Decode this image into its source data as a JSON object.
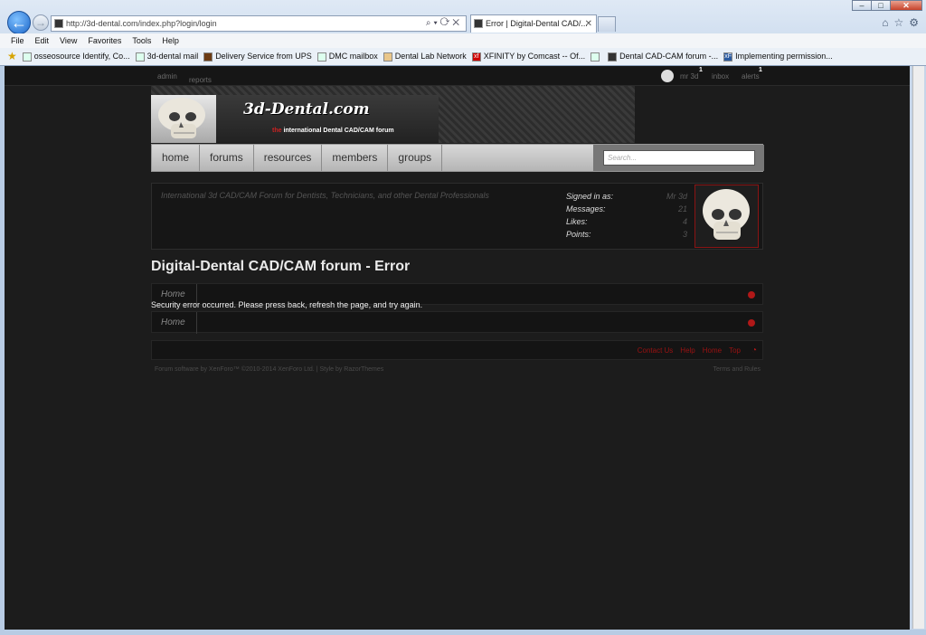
{
  "browser": {
    "address": "http://3d-dental.com/index.php?login/login",
    "tab_title": "Error | Digital-Dental CAD/...",
    "menu": [
      "File",
      "Edit",
      "View",
      "Favorites",
      "Tools",
      "Help"
    ],
    "favorites": [
      "osseosource Identify, Co...",
      "3d-dental mail",
      "Delivery Service from UPS",
      "DMC mailbox",
      "Dental Lab Network",
      "XFINITY by Comcast -- Of...",
      "",
      "Dental CAD-CAM forum -...",
      "Implementing permission..."
    ]
  },
  "topbar": {
    "admin": "admin",
    "reports": "reports",
    "user": "mr 3d",
    "inbox": "inbox",
    "alerts": "alerts",
    "user_badge": "1",
    "alerts_badge": "1"
  },
  "header": {
    "logo_title": "3d-Dental.com",
    "logo_sub_the": "the",
    "logo_sub_rest": "international Dental CAD/CAM forum"
  },
  "nav": {
    "tabs": [
      "home",
      "forums",
      "resources",
      "members",
      "groups"
    ],
    "search_placeholder": "Search..."
  },
  "info": {
    "tagline": "International 3d CAD/CAM Forum for Dentists, Technicians, and other Dental Professionals",
    "signed_in_label": "Signed in as:",
    "signed_in_value": "Mr 3d",
    "messages_label": "Messages:",
    "messages_value": "21",
    "likes_label": "Likes:",
    "likes_value": "4",
    "points_label": "Points:",
    "points_value": "3"
  },
  "content": {
    "title": "Digital-Dental CAD/CAM forum - Error",
    "breadcrumb_home": "Home",
    "error": "Security error occurred. Please press back, refresh the page, and try again."
  },
  "footer": {
    "links": [
      "Contact Us",
      "Help",
      "Home",
      "Top"
    ],
    "copyright": "Forum software by XenForo™ ©2010-2014 XenForo Ltd. | Style by RazorThemes",
    "terms": "Terms and Rules"
  }
}
